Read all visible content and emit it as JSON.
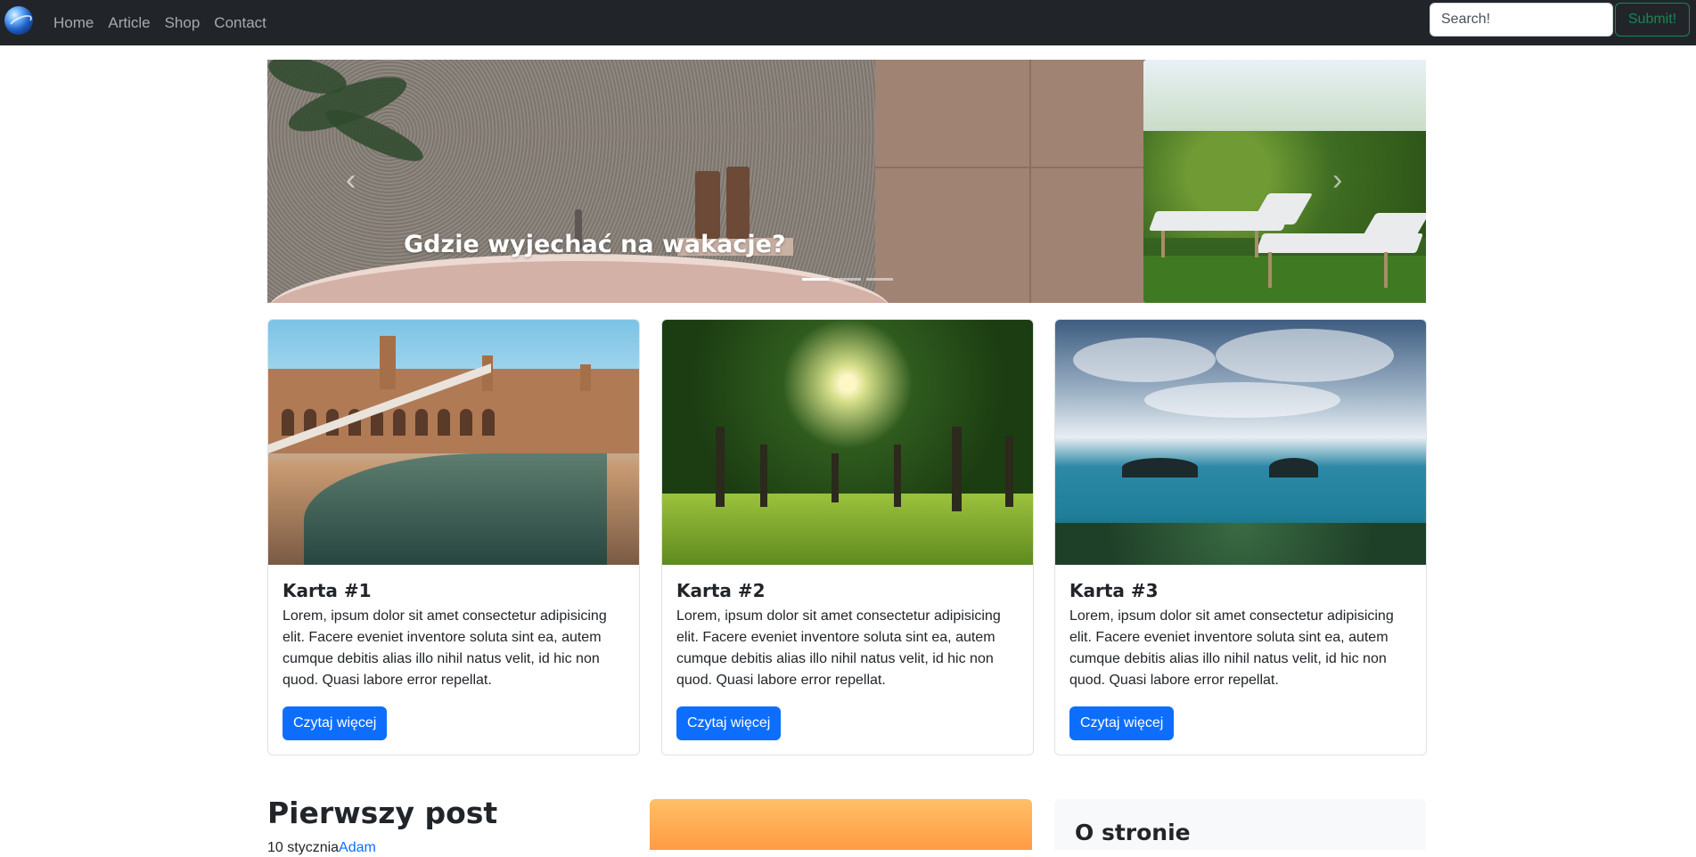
{
  "navbar": {
    "brand_icon": "globe-icon",
    "links": [
      "Home",
      "Article",
      "Shop",
      "Contact"
    ],
    "search_placeholder": "Search!",
    "submit_label": "Submit!",
    "colors": {
      "background": "#212529",
      "link": "#a6a8aa",
      "submit": "#198754"
    }
  },
  "carousel": {
    "caption": "Gdzie wyjechać na wakacje?",
    "prev_icon": "chevron-left-icon",
    "next_icon": "chevron-right-icon",
    "indicators": 3,
    "active_index": 0
  },
  "cards": [
    {
      "title": "Karta #1",
      "text": "Lorem, ipsum dolor sit amet consectetur adipisicing elit. Facere eveniet inventore soluta sint ea, autem cumque debitis alias illo nihil natus velit, id hic non quod. Quasi labore error repellat.",
      "button": "Czytaj więcej"
    },
    {
      "title": "Karta #2",
      "text": "Lorem, ipsum dolor sit amet consectetur adipisicing elit. Facere eveniet inventore soluta sint ea, autem cumque debitis alias illo nihil natus velit, id hic non quod. Quasi labore error repellat.",
      "button": "Czytaj więcej"
    },
    {
      "title": "Karta #3",
      "text": "Lorem, ipsum dolor sit amet consectetur adipisicing elit. Facere eveniet inventore soluta sint ea, autem cumque debitis alias illo nihil natus velit, id hic non quod. Quasi labore error repellat.",
      "button": "Czytaj więcej"
    }
  ],
  "post": {
    "title": "Pierwszy post",
    "date": "10 stycznia",
    "author": "Adam"
  },
  "sidebar": {
    "title": "O stronie"
  },
  "colors": {
    "primary": "#0d6efd",
    "card_border": "#dee2e6",
    "sidebar_bg": "#f8f9fa"
  }
}
